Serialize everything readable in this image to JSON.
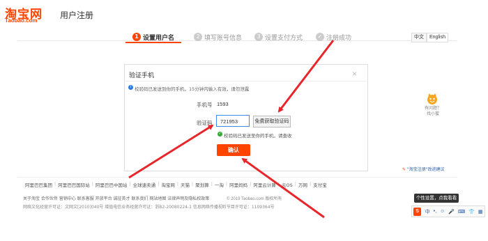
{
  "header": {
    "logo_cn": "淘宝网",
    "logo_en": "Taobao.com",
    "page_title": "用户注册"
  },
  "steps": [
    {
      "num": "1",
      "label": "设置用户名"
    },
    {
      "num": "2",
      "label": "填写账号信息"
    },
    {
      "num": "3",
      "label": "设置支付方式"
    },
    {
      "num": "✓",
      "label": "注册成功"
    }
  ],
  "lang": {
    "zh": "中文",
    "en": "English"
  },
  "modal": {
    "title": "验证手机",
    "close": "×",
    "info": "校验码已发送到你的手机，15分钟内输入有效，请勿泄露",
    "phone_label": "手机号",
    "phone_value": "1593",
    "code_label": "验证码",
    "code_value": "721953",
    "code_button": "免费获取验证码",
    "ok_message": "校验码已发送至你的手机，请查收",
    "confirm": "确认"
  },
  "help": {
    "line1": "有问题？",
    "line2": "找小蜜"
  },
  "feedback": "\"淘宝注册\"改进建议",
  "links": [
    "阿里巴巴集团",
    "阿里巴巴国际站",
    "阿里巴巴中国站",
    "全球速卖通",
    "淘宝网",
    "天猫",
    "聚划算",
    "一淘",
    "阿里妈妈",
    "阿里云计算",
    "云OS",
    "万网",
    "支付宝"
  ],
  "footer": {
    "line1": "关于淘宝 合作伙伴 营销中心 联系客服 开放平台 诚征英才 联系我们 网站地图 法律声明及隐私权政策",
    "copyright": "© 2019 Taobao.com 版权所有",
    "line2": "网络文化经营许可证：文网文[2010]040号 增值电信业务经营许可证：浙B2-20080224-1 信息网络传播视听节目许可证：1109364号"
  },
  "tooltip": "个性设置，点我看看",
  "ime": {
    "logo": "S",
    "items": [
      "中",
      "•,",
      "☺",
      "🎤",
      "⌨",
      "👕",
      "▦"
    ]
  },
  "colors": {
    "accent": "#ff4400",
    "link": "#2a5ea8",
    "arrow": "#e8262a"
  }
}
